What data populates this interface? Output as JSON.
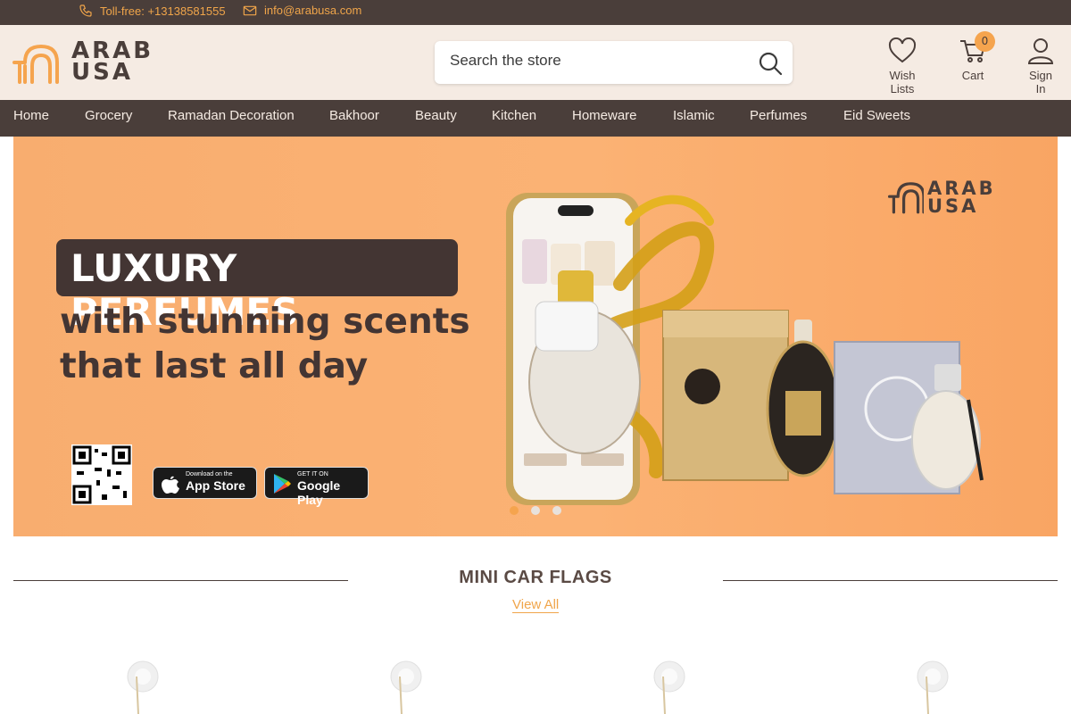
{
  "topbar": {
    "phone": "Toll-free: +13138581555",
    "email": "info@arabusa.com"
  },
  "header": {
    "logo_line1": "ARAB",
    "logo_line2": "USA",
    "search_placeholder": "Search the store",
    "wishlist_label": "Wish Lists",
    "cart_label": "Cart",
    "cart_count": "0",
    "signin_label": "Sign In"
  },
  "nav": {
    "items": [
      "Home",
      "Grocery",
      "Ramadan Decoration",
      "Bakhoor",
      "Beauty",
      "Kitchen",
      "Homeware",
      "Islamic",
      "Perfumes",
      "Eid Sweets"
    ]
  },
  "banner": {
    "headline": "LUXURY PERFUMES",
    "line2": "with stunning scents",
    "line3": "that last all day",
    "logo_line1": "ARAB",
    "logo_line2": "USA",
    "appstore_small": "Download on the",
    "appstore_big": "App Store",
    "googleplay_small": "GET IT ON",
    "googleplay_big": "Google Play",
    "slides": 3,
    "active_slide": 1
  },
  "section": {
    "title": "MINI CAR FLAGS",
    "view_all": "View All"
  },
  "colors": {
    "dark_brown": "#4a3e3a",
    "accent_orange": "#f5a44e",
    "header_bg": "#f5ebe3",
    "banner_bg": "#fbb274"
  }
}
